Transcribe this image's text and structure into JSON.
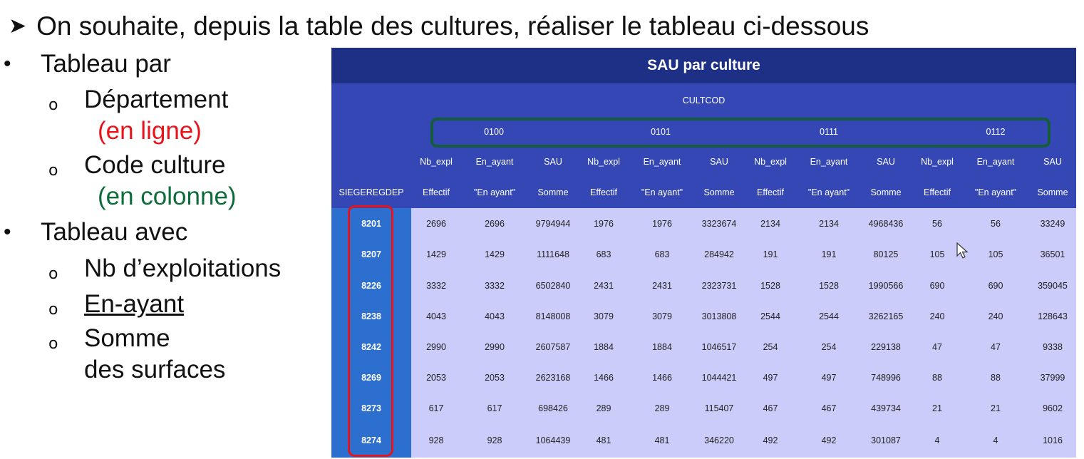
{
  "heading": "On souhaite, depuis la table des cultures, réaliser le tableau ci-dessous",
  "left_panel": {
    "tableau_par": "Tableau par",
    "departement": "Département",
    "en_ligne": "(en ligne)",
    "code_culture": "Code culture",
    "en_colonne": "(en colonne)",
    "tableau_avec": "Tableau avec",
    "nb_exploitations": "Nb d’exploitations",
    "en_ayant": "En-ayant",
    "somme": "Somme",
    "des_surfaces": "des surfaces"
  },
  "table": {
    "title": "SAU par culture",
    "column_var": "CULTCOD",
    "row_var": "SIEGEREGDEP",
    "codes": [
      "0100",
      "0101",
      "0111",
      "0112"
    ],
    "measures": [
      "Nb_expl",
      "En_ayant",
      "SAU"
    ],
    "stats": [
      "Effectif",
      "\"En ayant\"",
      "Somme"
    ],
    "rows": [
      {
        "dep": "8201",
        "values": [
          "2696",
          "2696",
          "9794944",
          "1976",
          "1976",
          "3323674",
          "2134",
          "2134",
          "4968436",
          "56",
          "56",
          "33249"
        ]
      },
      {
        "dep": "8207",
        "values": [
          "1429",
          "1429",
          "1111648",
          "683",
          "683",
          "284942",
          "191",
          "191",
          "80125",
          "105",
          "105",
          "36501"
        ]
      },
      {
        "dep": "8226",
        "values": [
          "3332",
          "3332",
          "6502840",
          "2431",
          "2431",
          "2323731",
          "1528",
          "1528",
          "1990566",
          "690",
          "690",
          "359045"
        ]
      },
      {
        "dep": "8238",
        "values": [
          "4043",
          "4043",
          "8148008",
          "3079",
          "3079",
          "3013808",
          "2544",
          "2544",
          "3262165",
          "240",
          "240",
          "128643"
        ]
      },
      {
        "dep": "8242",
        "values": [
          "2990",
          "2990",
          "2607587",
          "1884",
          "1884",
          "1046517",
          "254",
          "254",
          "229138",
          "47",
          "47",
          "9338"
        ]
      },
      {
        "dep": "8269",
        "values": [
          "2053",
          "2053",
          "2623168",
          "1466",
          "1466",
          "1044421",
          "497",
          "497",
          "748996",
          "88",
          "88",
          "37999"
        ]
      },
      {
        "dep": "8273",
        "values": [
          "617",
          "617",
          "698426",
          "289",
          "289",
          "115407",
          "467",
          "467",
          "439734",
          "21",
          "21",
          "9602"
        ]
      },
      {
        "dep": "8274",
        "values": [
          "928",
          "928",
          "1064439",
          "481",
          "481",
          "346220",
          "492",
          "492",
          "301087",
          "4",
          "4",
          "1016"
        ]
      }
    ]
  },
  "colors": {
    "title_bg": "#1e2f86",
    "header_bg": "#3547b4",
    "body_bg": "#ccccfb",
    "side_bg": "#2d6fcf",
    "red": "#e8141c",
    "green": "#0d6d3a"
  }
}
